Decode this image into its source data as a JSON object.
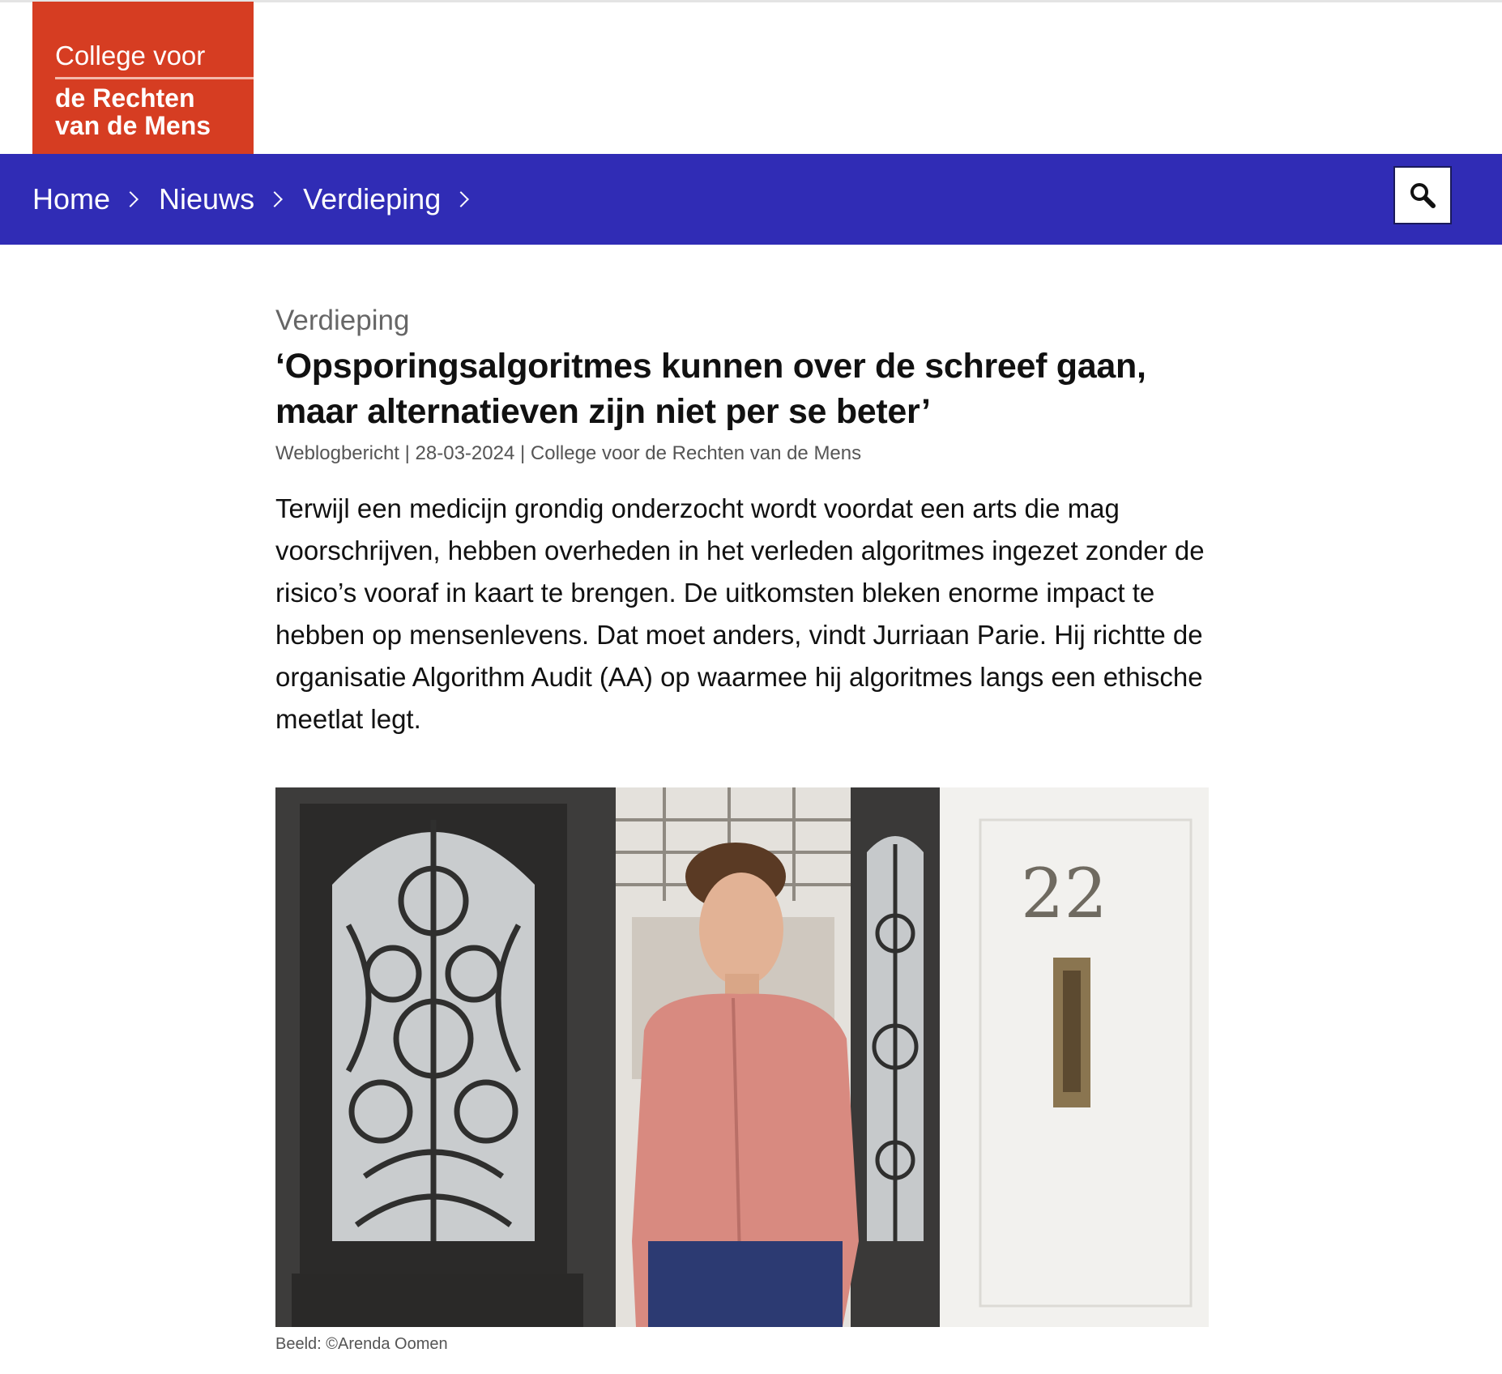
{
  "logo": {
    "line1": "College voor",
    "line2": "de Rechten",
    "line3": "van de Mens",
    "color": "#d63d22"
  },
  "nav": {
    "color": "#302cb5",
    "breadcrumbs": [
      "Home",
      "Nieuws",
      "Verdieping"
    ],
    "search_icon": "search-icon"
  },
  "article": {
    "category": "Verdieping",
    "title_line1": "‘Opsporingsalgoritmes kunnen over de schreef gaan,",
    "title_line2": "maar alternatieven zijn niet per se beter’",
    "meta": "Weblogbericht | 28-03-2024 | College voor de Rechten van de Mens",
    "intro": "Terwijl een medicijn grondig onderzocht wordt voordat een arts die mag voorschrijven, hebben overheden in het verleden algoritmes ingezet zonder de risico’s vooraf in kaart te brengen. De uitkomsten bleken enorme impact te hebben op mensenlevens. Dat moet anders, vindt Jurriaan Parie. Hij richtte de organisatie Algorithm Audit (AA) op waarmee hij algoritmes langs een ethische meetlat legt.",
    "photo": {
      "house_number": "22",
      "caption": "Beeld: ©Arenda Oomen"
    }
  }
}
